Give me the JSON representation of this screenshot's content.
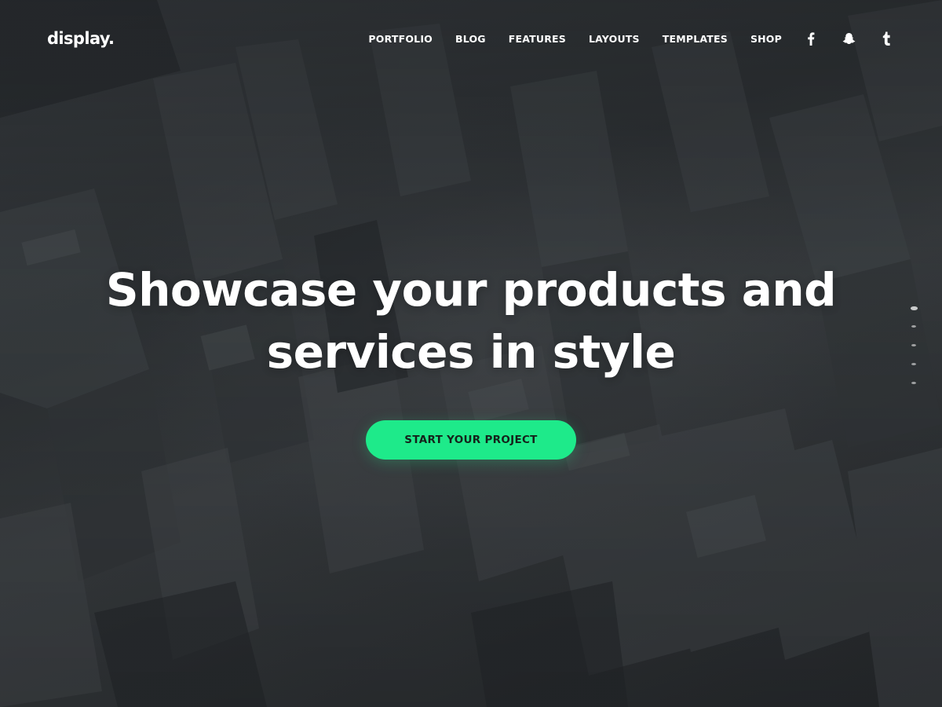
{
  "brand": {
    "logo": "display."
  },
  "nav": {
    "items": [
      {
        "label": "PORTFOLIO"
      },
      {
        "label": "BLOG"
      },
      {
        "label": "FEATURES"
      },
      {
        "label": "LAYOUTS"
      },
      {
        "label": "TEMPLATES"
      },
      {
        "label": "SHOP"
      }
    ]
  },
  "socials": [
    {
      "icon": "facebook-icon"
    },
    {
      "icon": "snapchat-icon"
    },
    {
      "icon": "tumblr-icon"
    }
  ],
  "hero": {
    "title_line1": "Showcase your products and",
    "title_line2": "services in style",
    "cta_label": "START YOUR PROJECT",
    "background": "aerial-city-photo"
  },
  "slider": {
    "count": 5,
    "active_index": 0
  },
  "colors": {
    "accent": "#1eea8a",
    "text": "#ffffff",
    "background": "#2a2d30"
  }
}
